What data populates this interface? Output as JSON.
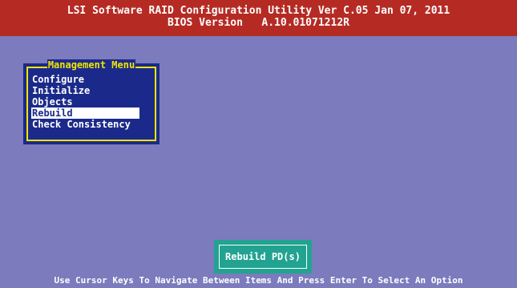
{
  "header": {
    "line1": "LSI Software RAID Configuration Utility Ver C.05 Jan 07, 2011",
    "line2": "BIOS Version   A.10.01071212R"
  },
  "menu": {
    "title": "Management Menu",
    "items": [
      "Configure",
      "Initialize",
      "Objects",
      "Rebuild",
      "Check Consistency"
    ],
    "selected": "Rebuild"
  },
  "status": {
    "label": "Rebuild PD(s)"
  },
  "footer": {
    "hint": "Use Cursor Keys To Navigate Between Items And Press Enter To Select An Option"
  },
  "colors": {
    "background": "#7b7bbd",
    "header": "#b52b24",
    "menu_panel": "#1b2a8a",
    "menu_border": "#f2e400",
    "status_box": "#22a391"
  }
}
